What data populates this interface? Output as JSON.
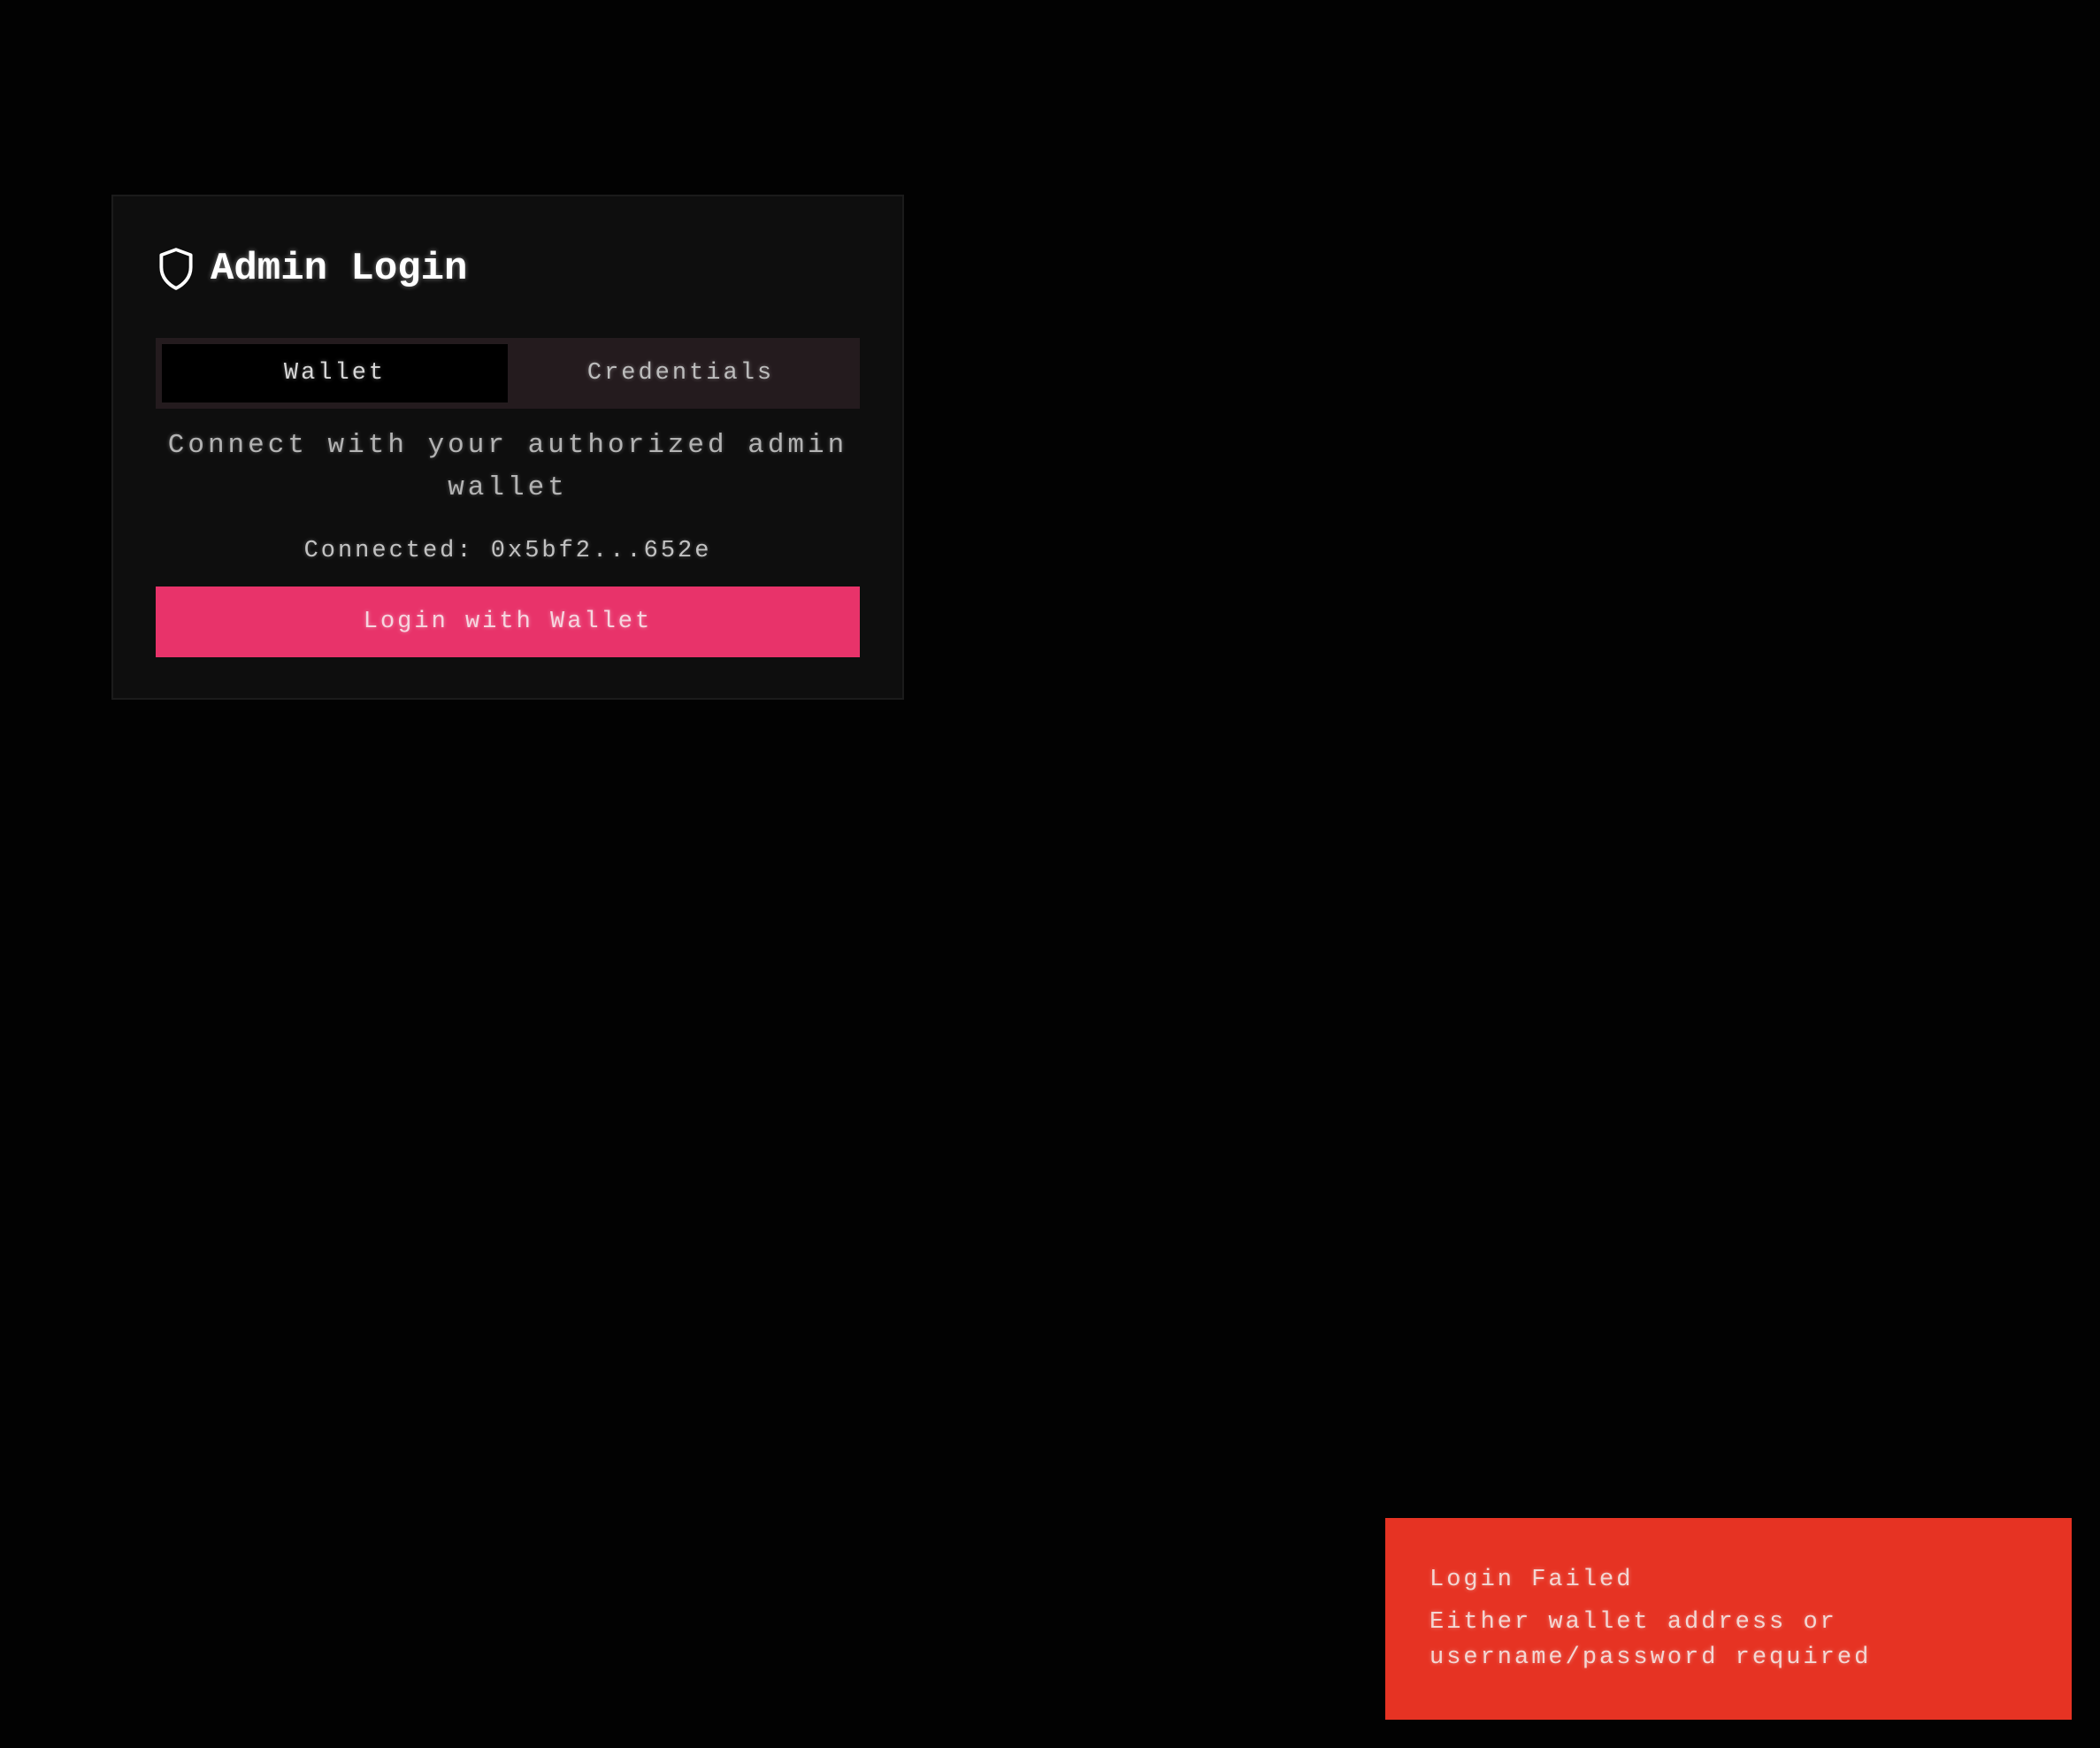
{
  "login_card": {
    "title": "Admin Login",
    "header_icon": "shield-icon",
    "tabs": [
      {
        "label": "Wallet",
        "active": true
      },
      {
        "label": "Credentials",
        "active": false
      }
    ],
    "description": "Connect with your authorized admin wallet",
    "connected_status": "Connected: 0x5bf2...652e",
    "login_button_label": "Login with Wallet"
  },
  "toast": {
    "title": "Login Failed",
    "message": "Either wallet address or username/password required"
  },
  "colors": {
    "background": "#020202",
    "card_background": "#0e0e0e",
    "tab_bar_background": "#241b1e",
    "accent_button": "#e8336a",
    "error_toast": "#e63323"
  }
}
